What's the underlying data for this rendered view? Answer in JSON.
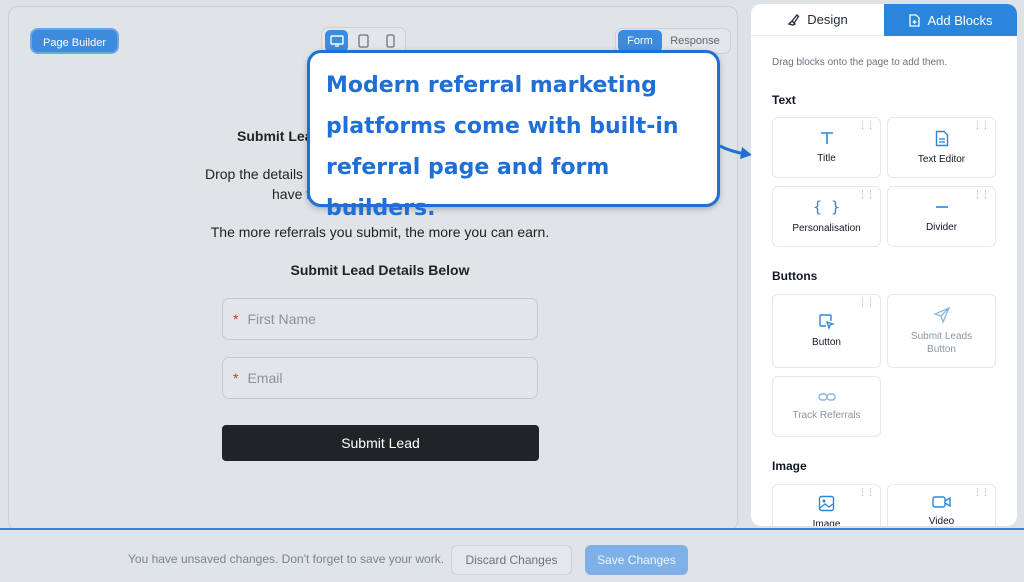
{
  "toolbar": {
    "page_builder_label": "Page Builder",
    "view_tabs": [
      "Form",
      "Response"
    ]
  },
  "form": {
    "heading": "Submit Lead",
    "drop_line_1": "Drop the details o",
    "drop_line_2": "have t",
    "earn_text": "The more referrals you submit, the more you can earn.",
    "section_title": "Submit Lead Details Below",
    "first_name_placeholder": "First Name",
    "email_placeholder": "Email",
    "required_mark": "*",
    "submit_label": "Submit Lead"
  },
  "callout": {
    "line_1": "Modern referral marketing",
    "line_2": "platforms come with built-in",
    "line_3": "referral page and form builders."
  },
  "panel": {
    "tab_design": "Design",
    "tab_add_blocks": "Add Blocks",
    "hint": "Drag blocks onto the page to add them.",
    "sections": {
      "text": "Text",
      "buttons": "Buttons",
      "image": "Image"
    },
    "blocks": {
      "title": "Title",
      "text_editor": "Text Editor",
      "personalisation": "Personalisation",
      "divider": "Divider",
      "button": "Button",
      "submit_leads_button": "Submit Leads Button",
      "track_referrals": "Track Referrals",
      "image": "Image",
      "video": "Video"
    }
  },
  "bottom_bar": {
    "message": "You have unsaved changes. Don't forget to save your work.",
    "discard_label": "Discard Changes",
    "save_label": "Save Changes"
  },
  "colors": {
    "accent": "#2a86dc",
    "callout_blue": "#1f6fd6",
    "dark_button": "#202426"
  }
}
